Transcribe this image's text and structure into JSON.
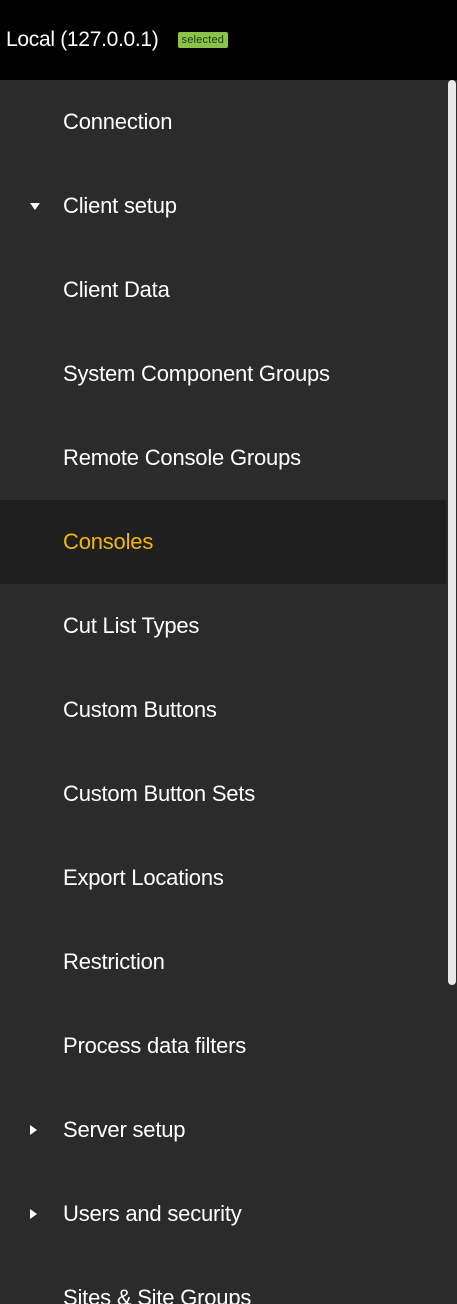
{
  "header": {
    "title": "Local (127.0.0.1)",
    "badge": "selected",
    "badge_color": "#8bc34a"
  },
  "nav": {
    "items": [
      {
        "label": "Connection",
        "caret": null,
        "active": false
      },
      {
        "label": "Client setup",
        "caret": "down",
        "active": false
      },
      {
        "label": "Client Data",
        "caret": null,
        "active": false
      },
      {
        "label": "System Component Groups",
        "caret": null,
        "active": false
      },
      {
        "label": "Remote Console Groups",
        "caret": null,
        "active": false
      },
      {
        "label": "Consoles",
        "caret": null,
        "active": true
      },
      {
        "label": "Cut List Types",
        "caret": null,
        "active": false
      },
      {
        "label": "Custom Buttons",
        "caret": null,
        "active": false
      },
      {
        "label": "Custom Button Sets",
        "caret": null,
        "active": false
      },
      {
        "label": "Export Locations",
        "caret": null,
        "active": false
      },
      {
        "label": "Restriction",
        "caret": null,
        "active": false
      },
      {
        "label": "Process data filters",
        "caret": null,
        "active": false
      },
      {
        "label": "Server setup",
        "caret": "right",
        "active": false
      },
      {
        "label": "Users and security",
        "caret": "right",
        "active": false
      },
      {
        "label": "Sites & Site Groups",
        "caret": null,
        "active": false
      }
    ]
  },
  "colors": {
    "background": "#2b2b2b",
    "header_background": "#000000",
    "active_background": "#1f1f1f",
    "active_text": "#f2b705",
    "text": "#ffffff",
    "scrollbar_thumb": "#e8e8e8"
  }
}
